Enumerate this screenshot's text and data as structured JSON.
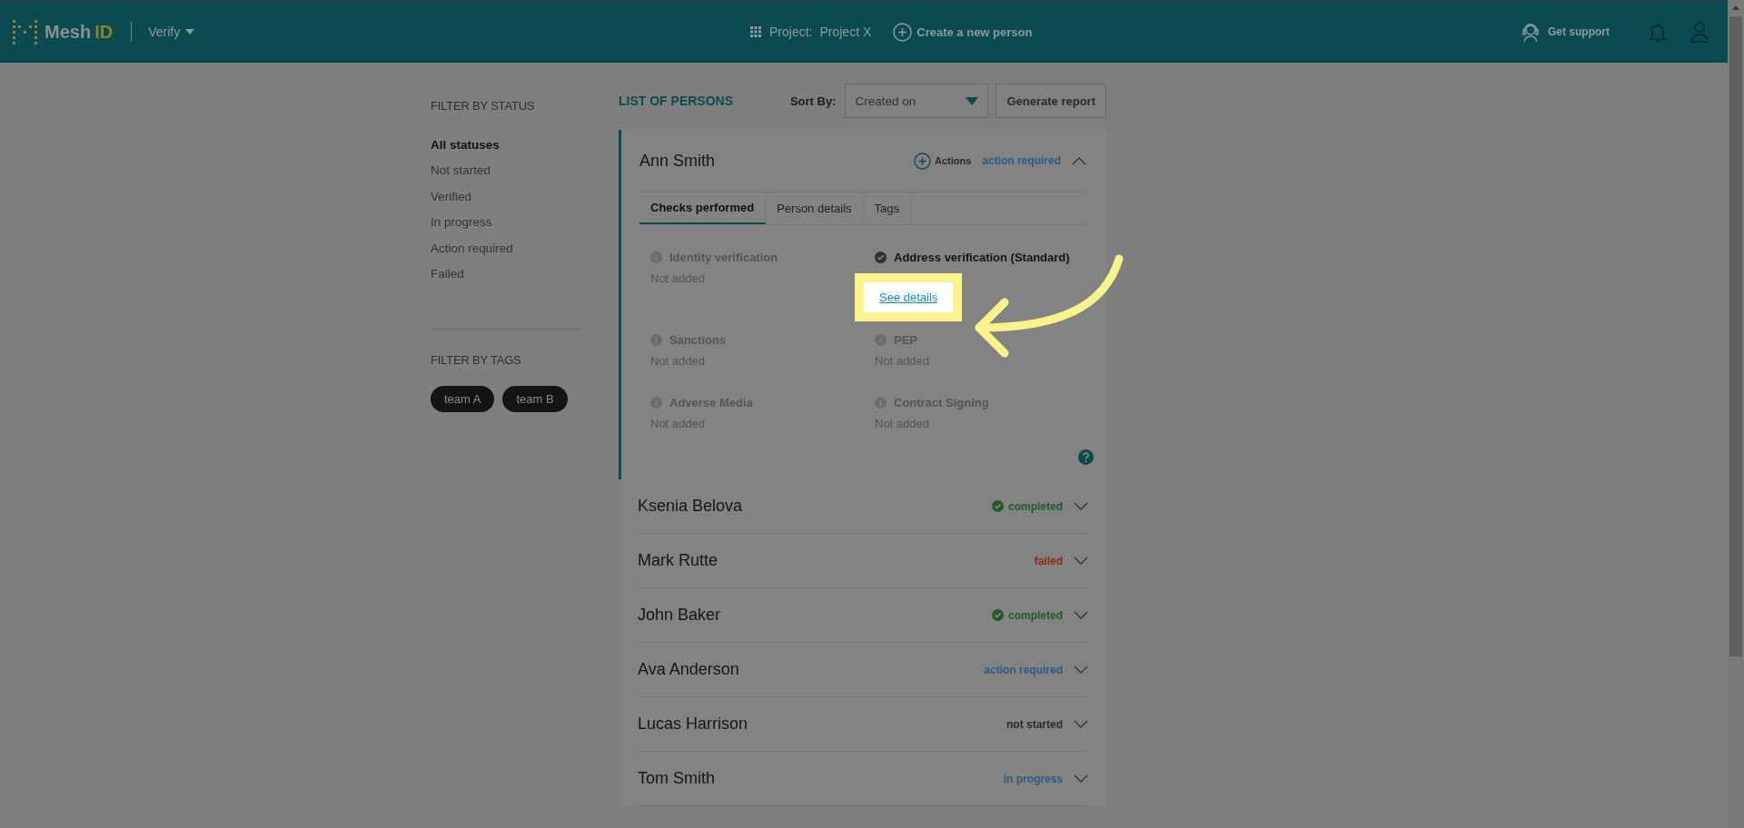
{
  "header": {
    "logo": {
      "first": "Mesh",
      "second": "ID"
    },
    "product": "Verify",
    "project_label": "Project:",
    "project_name": "Project X",
    "create_button": "Create a new person",
    "support": "Get support"
  },
  "filters": {
    "status_title": "FILTER BY STATUS",
    "statuses": [
      {
        "label": "All statuses",
        "selected": true
      },
      {
        "label": "Not started",
        "selected": false
      },
      {
        "label": "Verified",
        "selected": false
      },
      {
        "label": "In progress",
        "selected": false
      },
      {
        "label": "Action required",
        "selected": false
      },
      {
        "label": "Failed",
        "selected": false
      }
    ],
    "tags_title": "FILTER BY TAGS",
    "tags": [
      "team A",
      "team B"
    ]
  },
  "list": {
    "title": "LIST OF PERSONS",
    "sort_label": "Sort By:",
    "sort_value": "Created on",
    "report_button": "Generate report",
    "persons": [
      {
        "name": "Ann Smith",
        "expanded": true,
        "actions": "Actions",
        "status": {
          "label": "action required",
          "kind": "action"
        },
        "tabs": [
          {
            "label": "Checks performed",
            "selected": true
          },
          {
            "label": "Person details",
            "selected": false
          },
          {
            "label": "Tags",
            "selected": false
          }
        ],
        "checks": [
          {
            "title": "Identity verification",
            "added": false,
            "note": "Not added"
          },
          {
            "title": "Address verification (Standard)",
            "added": true,
            "link": "See details"
          },
          {
            "title": "Sanctions",
            "added": false,
            "note": "Not added"
          },
          {
            "title": "PEP",
            "added": false,
            "note": "Not added"
          },
          {
            "title": "Adverse Media",
            "added": false,
            "note": "Not added"
          },
          {
            "title": "Contract Signing",
            "added": false,
            "note": "Not added"
          }
        ]
      },
      {
        "name": "Ksenia Belova",
        "expanded": false,
        "status": {
          "label": "completed",
          "kind": "completed"
        }
      },
      {
        "name": "Mark Rutte",
        "expanded": false,
        "status": {
          "label": "failed",
          "kind": "failed"
        }
      },
      {
        "name": "John Baker",
        "expanded": false,
        "status": {
          "label": "completed",
          "kind": "completed"
        }
      },
      {
        "name": "Ava Anderson",
        "expanded": false,
        "status": {
          "label": "action required",
          "kind": "action"
        }
      },
      {
        "name": "Lucas Harrison",
        "expanded": false,
        "status": {
          "label": "not started",
          "kind": "not-started"
        }
      },
      {
        "name": "Tom Smith",
        "expanded": false,
        "status": {
          "label": "in progress",
          "kind": "progress"
        }
      }
    ]
  }
}
